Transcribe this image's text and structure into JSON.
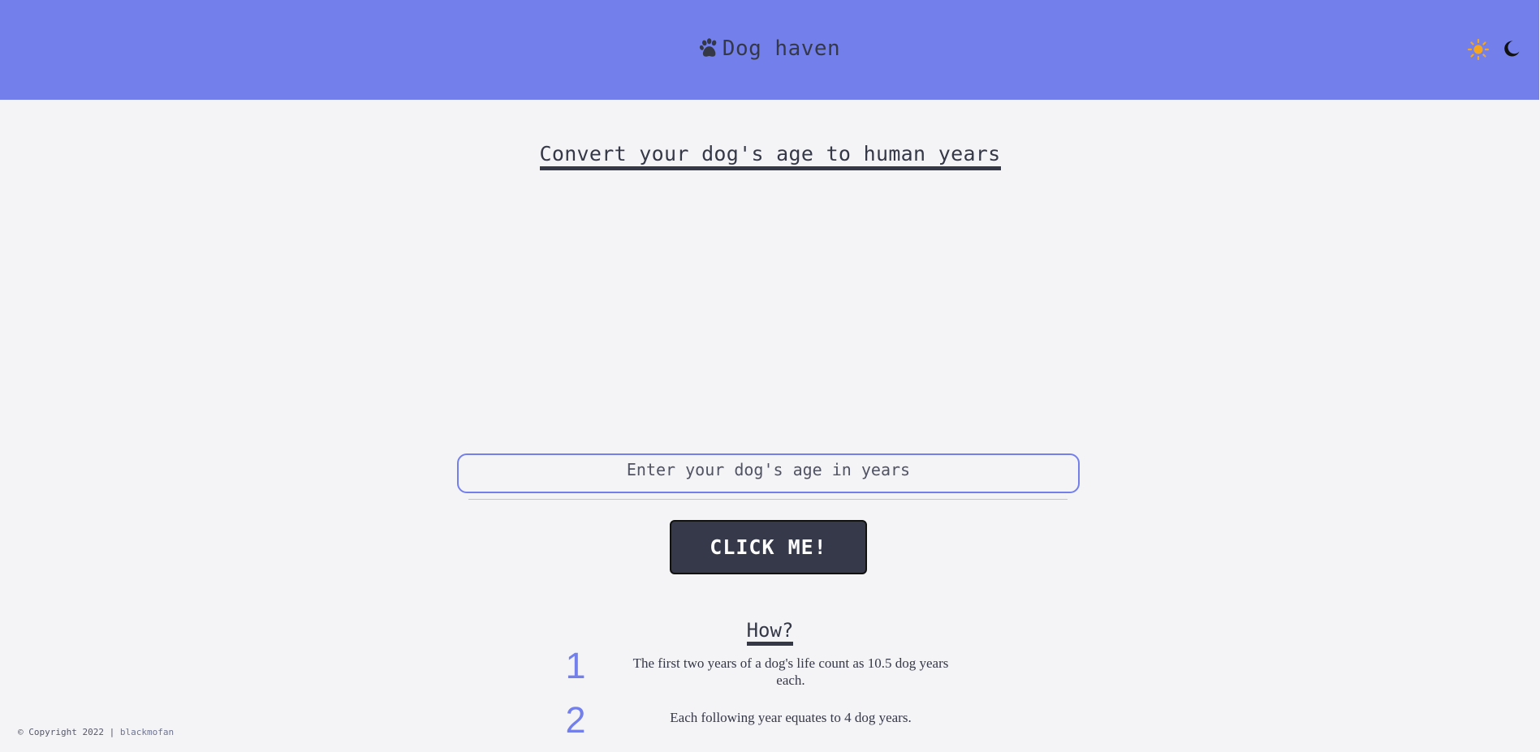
{
  "header": {
    "brand_title": "Dog haven",
    "brand_icon": "paw-icon",
    "theme_toggle": {
      "light_icon": "sun-icon",
      "dark_icon": "moon-icon"
    }
  },
  "main": {
    "heading": "Convert your dog's age to human years",
    "input": {
      "placeholder": "Enter your dog's age in years",
      "value": ""
    },
    "button_label": "CLICK ME!"
  },
  "how": {
    "heading": "How?",
    "steps": [
      {
        "number": "1",
        "text": "The first two years of a dog's life count as 10.5 dog years each."
      },
      {
        "number": "2",
        "text": "Each following year equates to 4 dog years."
      }
    ]
  },
  "footer": {
    "copyright": "© Copyright 2022 |",
    "author": "blackmofan"
  },
  "colors": {
    "accent": "#7380ec",
    "dark": "#363949",
    "background": "#f4f4f7",
    "sun": "#f7a51c"
  }
}
